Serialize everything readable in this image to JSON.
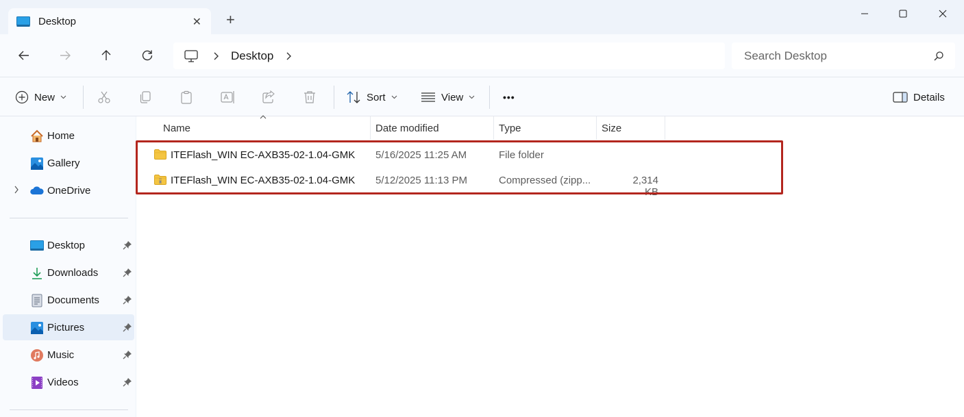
{
  "window": {
    "tab_title": "Desktop",
    "tab_close": "✕",
    "new_tab": "+"
  },
  "address": {
    "crumb": "Desktop"
  },
  "search": {
    "placeholder": "Search Desktop"
  },
  "toolbar": {
    "new_label": "New",
    "sort_label": "Sort",
    "view_label": "View",
    "more_label": "•••",
    "details_label": "Details"
  },
  "sidebar": {
    "items": [
      {
        "label": "Home"
      },
      {
        "label": "Gallery"
      },
      {
        "label": "OneDrive"
      },
      {
        "label": "Desktop"
      },
      {
        "label": "Downloads"
      },
      {
        "label": "Documents"
      },
      {
        "label": "Pictures"
      },
      {
        "label": "Music"
      },
      {
        "label": "Videos"
      }
    ]
  },
  "columns": {
    "name": "Name",
    "date": "Date modified",
    "type": "Type",
    "size": "Size"
  },
  "files": [
    {
      "name": "ITEFlash_WIN EC-AXB35-02-1.04-GMK",
      "date": "5/16/2025 11:25 AM",
      "type": "File folder",
      "size": ""
    },
    {
      "name": "ITEFlash_WIN EC-AXB35-02-1.04-GMK",
      "date": "5/12/2025 11:13 PM",
      "type": "Compressed (zipp...",
      "size": "2,314 KB"
    }
  ],
  "colors": {
    "accent": "#0067c0",
    "highlight_border": "#b3261e",
    "folder": "#f4c542"
  }
}
